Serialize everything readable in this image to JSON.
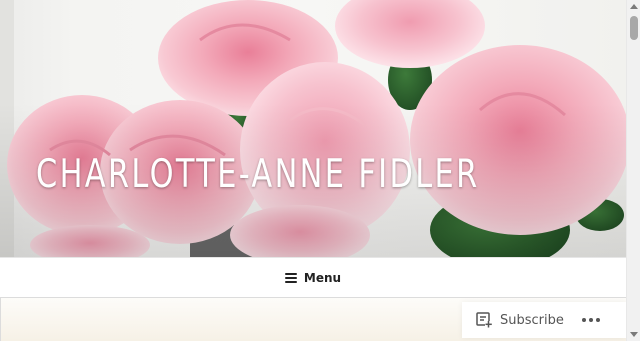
{
  "header": {
    "site_title": "CHARLOTTE-ANNE FIDLER",
    "hero_image": "pink-roses-bouquet"
  },
  "nav": {
    "menu_label": "Menu",
    "menu_icon": "hamburger-icon"
  },
  "actionbar": {
    "subscribe_label": "Subscribe",
    "subscribe_icon": "reader-subscribe-icon",
    "more_icon": "ellipsis-icon"
  },
  "colors": {
    "title_text": "#ffffff",
    "menu_text": "#222222",
    "action_text": "#555555",
    "rose_pink": "#f2a9b8"
  }
}
